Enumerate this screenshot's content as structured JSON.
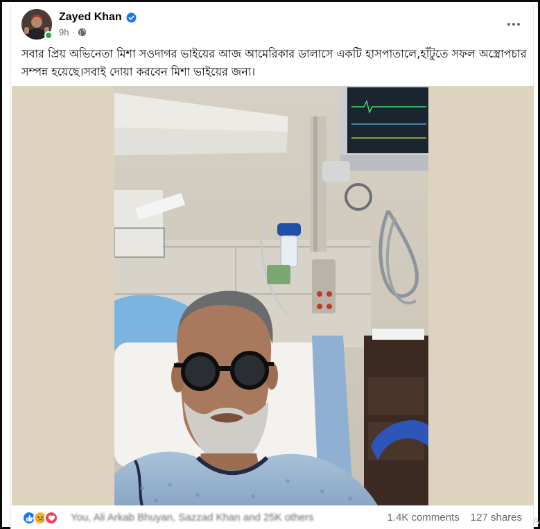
{
  "post": {
    "author": "Zayed Khan",
    "time": "9h",
    "text": "সবার প্রিয় অভিনেতা মিশা সওদাগর ভাইয়ের আজ আমেরিকার ডালাসে একটি হাসপাতালে,হাঁটুতে সফল অস্ত্রোপচার সম্পন্ন হয়েছে।সবাই দোয়া করবেন মিশা ভাইয়ের জন্য।",
    "reactors": "You, Ali Arkab Bhuyan, Sazzad Khan and 25K others",
    "comments": "1.4K comments",
    "shares": "127 shares",
    "edge_label": "Ac"
  },
  "icons": {
    "verified": "verified-badge-icon",
    "audience": "globe-icon",
    "more": "more-options-icon",
    "reactions": [
      "like-icon",
      "sad-icon",
      "love-icon"
    ]
  },
  "colors": {
    "brand_blue": "#1877f2",
    "secondary_text": "#65676b",
    "online_green": "#31a24c",
    "love_red": "#f33e58",
    "sad_yellow": "#f7b125"
  }
}
